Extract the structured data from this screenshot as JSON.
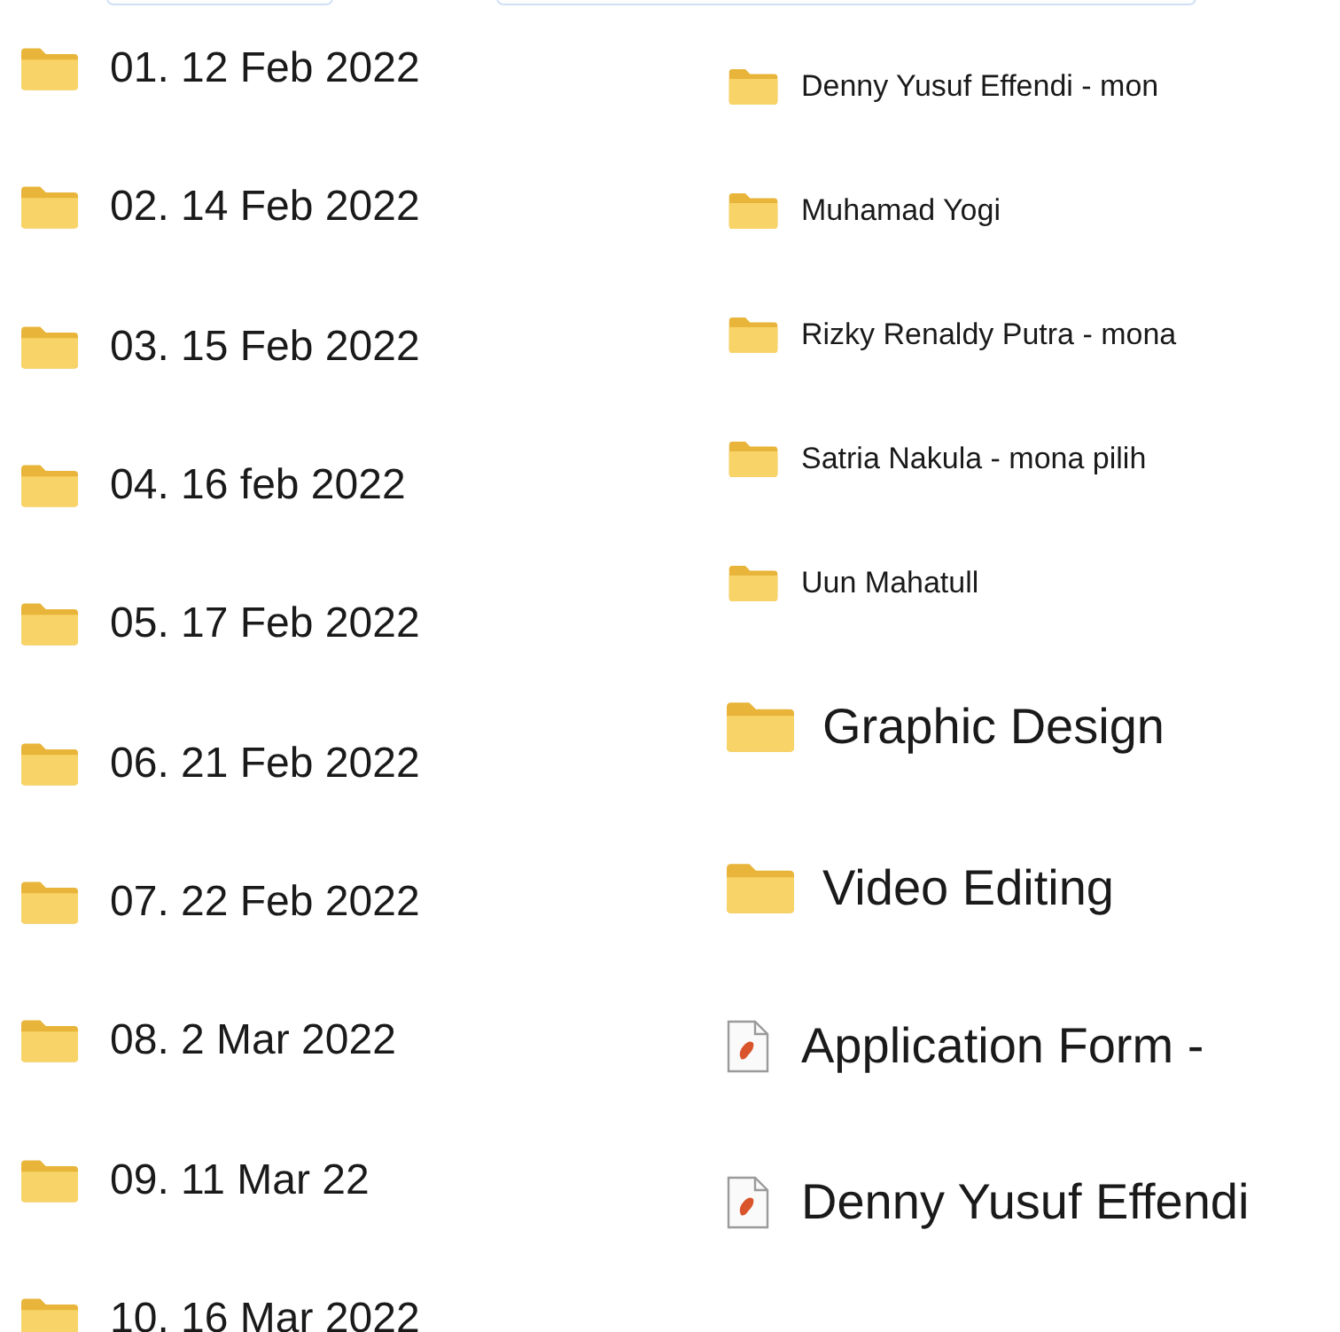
{
  "left_items": [
    {
      "kind": "folder",
      "name": "01. 12 Feb 2022"
    },
    {
      "kind": "folder",
      "name": "02. 14 Feb 2022"
    },
    {
      "kind": "folder",
      "name": "03. 15 Feb 2022"
    },
    {
      "kind": "folder",
      "name": "04. 16 feb 2022"
    },
    {
      "kind": "folder",
      "name": "05. 17 Feb 2022"
    },
    {
      "kind": "folder",
      "name": "06. 21 Feb 2022"
    },
    {
      "kind": "folder",
      "name": "07. 22 Feb 2022"
    },
    {
      "kind": "folder",
      "name": "08. 2 Mar 2022"
    },
    {
      "kind": "folder",
      "name": "09. 11 Mar 22"
    },
    {
      "kind": "folder",
      "name": "10. 16 Mar 2022"
    }
  ],
  "right_items": [
    {
      "kind": "small-folder",
      "name": "Denny Yusuf Effendi - mon"
    },
    {
      "kind": "small-folder",
      "name": "Muhamad Yogi"
    },
    {
      "kind": "small-folder",
      "name": "Rizky Renaldy Putra - mona"
    },
    {
      "kind": "small-folder",
      "name": "Satria Nakula - mona pilih"
    },
    {
      "kind": "small-folder",
      "name": "Uun Mahatull"
    },
    {
      "kind": "large-folder",
      "name": "Graphic Design"
    },
    {
      "kind": "large-folder",
      "name": "Video Editing"
    },
    {
      "kind": "pdf",
      "name": "Application Form -"
    },
    {
      "kind": "pdf",
      "name": "Denny Yusuf Effendi"
    }
  ]
}
